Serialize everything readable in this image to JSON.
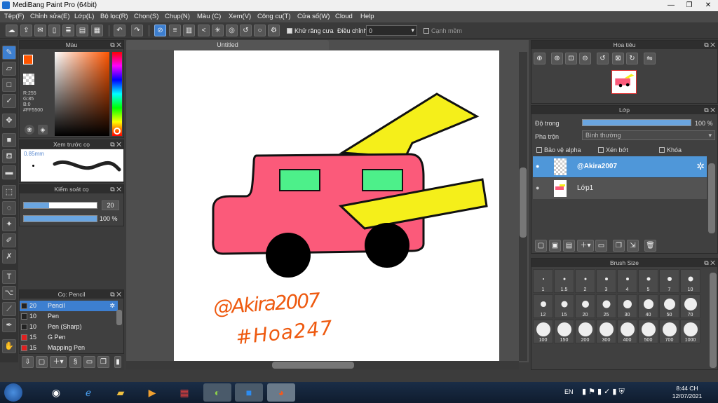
{
  "window": {
    "title": "MediBang Paint Pro (64bit)"
  },
  "menu": [
    "Tệp(F)",
    "Chỉnh sửa(E)",
    "Lớp(L)",
    "Bộ lọc(R)",
    "Chọn(S)",
    "Chụp(N)",
    "Màu (C)",
    "Xem(V)",
    "Công cụ(T)",
    "Cửa số(W)",
    "Cloud",
    "Help"
  ],
  "toolbar": {
    "antialias_label": "Khử răng cưa",
    "adjust_label": "Điều chỉnh",
    "adjust_value": "0",
    "snap_label": "Cạnh mềm"
  },
  "color_panel": {
    "title": "Màu",
    "r": "R:255",
    "g": "G:85",
    "b": "B:0",
    "hex": "#FF5500",
    "primary": "#ff5500"
  },
  "preview_panel": {
    "title": "Xem trước cọ",
    "size": "0.85mm"
  },
  "brush_control": {
    "title": "Kiểm soát cọ",
    "size": "20",
    "opacity": "100 %",
    "size_fraction": 0.35,
    "opacity_fraction": 1.0
  },
  "brush_panel": {
    "title": "Cọ: Pencil",
    "items": [
      {
        "size": "20",
        "name": "Pencil",
        "color": "#222222",
        "selected": true
      },
      {
        "size": "10",
        "name": "Pen",
        "color": "#222222",
        "selected": false
      },
      {
        "size": "10",
        "name": "Pen (Sharp)",
        "color": "#222222",
        "selected": false
      },
      {
        "size": "15",
        "name": "G Pen",
        "color": "#e02020",
        "selected": false
      },
      {
        "size": "15",
        "name": "Mapping Pen",
        "color": "#e02020",
        "selected": false
      }
    ]
  },
  "canvas": {
    "tab": "Untitled",
    "signature": "@Akira2007",
    "tag": "#Hoa247"
  },
  "navigator": {
    "title": "Hoa tiêu"
  },
  "layer_panel": {
    "title": "Lớp",
    "opacity_label": "Độ trong",
    "opacity_value": "100 %",
    "opacity_fraction": 1.0,
    "blend_label": "Pha trộn",
    "blend_value": "Bình thường",
    "protect_alpha": "Bảo vệ alpha",
    "clipping": "Xén bớt",
    "lock": "Khóa",
    "layers": [
      {
        "name": "@Akira2007",
        "selected": true
      },
      {
        "name": "Lớp1",
        "selected": false
      }
    ]
  },
  "brush_size_panel": {
    "title": "Brush Size",
    "sizes": [
      "1",
      "1.5",
      "2",
      "3",
      "4",
      "5",
      "7",
      "10",
      "12",
      "15",
      "20",
      "25",
      "30",
      "40",
      "50",
      "70",
      "100",
      "150",
      "200",
      "300",
      "400",
      "500",
      "700",
      "1000"
    ]
  },
  "taskbar": {
    "lang": "EN",
    "time": "8:44 CH",
    "date": "12/07/2021"
  }
}
